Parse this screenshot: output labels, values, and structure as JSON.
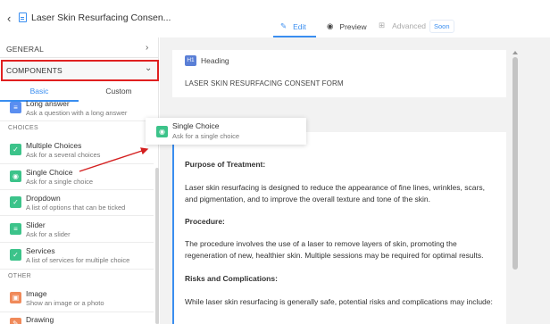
{
  "header": {
    "back_icon": "chevron-left-icon",
    "doc_icon": "document-icon",
    "title": "Laser Skin Resurfacing Consen...",
    "tabs": {
      "edit": "Edit",
      "preview": "Preview",
      "advanced": "Advanced",
      "soon": "Soon"
    }
  },
  "sidebar": {
    "general": "GENERAL",
    "components": "COMPONENTS",
    "tab_basic": "Basic",
    "tab_custom": "Custom",
    "long_answer": {
      "label": "Long answer",
      "desc": "Ask a question with a long answer"
    },
    "choices_header": "CHOICES",
    "multiple_choices": {
      "label": "Multiple Choices",
      "desc": "Ask for a several choices"
    },
    "single_choice": {
      "label": "Single Choice",
      "desc": "Ask for a single choice"
    },
    "dropdown": {
      "label": "Dropdown",
      "desc": "A list of options that can be ticked"
    },
    "slider": {
      "label": "Slider",
      "desc": "Ask for a slider"
    },
    "services": {
      "label": "Services",
      "desc": "A list of services for multiple choice"
    },
    "other_header": "OTHER",
    "image": {
      "label": "Image",
      "desc": "Show an image or a photo"
    },
    "drawing": {
      "label": "Drawing"
    }
  },
  "drag_ghost": {
    "label": "Single Choice",
    "desc": "Ask for a single choice"
  },
  "canvas": {
    "heading_badge": "H1",
    "heading_label": "Heading",
    "heading_value": "LASER SKIN RESURFACING CONSENT FORM",
    "purpose_title": "Purpose of Treatment:",
    "purpose_text": "Laser skin resurfacing is designed to reduce the appearance of fine lines, wrinkles, scars, and pigmentation, and to improve the overall texture and tone of the skin.",
    "procedure_title": "Procedure:",
    "procedure_text": "The procedure involves the use of a laser to remove layers of skin, promoting the regeneration of new, healthier skin. Multiple sessions may be required for optimal results.",
    "risks_title": "Risks and Complications:",
    "risks_text": "While laser skin resurfacing is generally safe, potential risks and complications may include:"
  },
  "colors": {
    "accent": "#3a8ef0",
    "highlight": "#e02020",
    "choice_green": "#3cc38a"
  }
}
